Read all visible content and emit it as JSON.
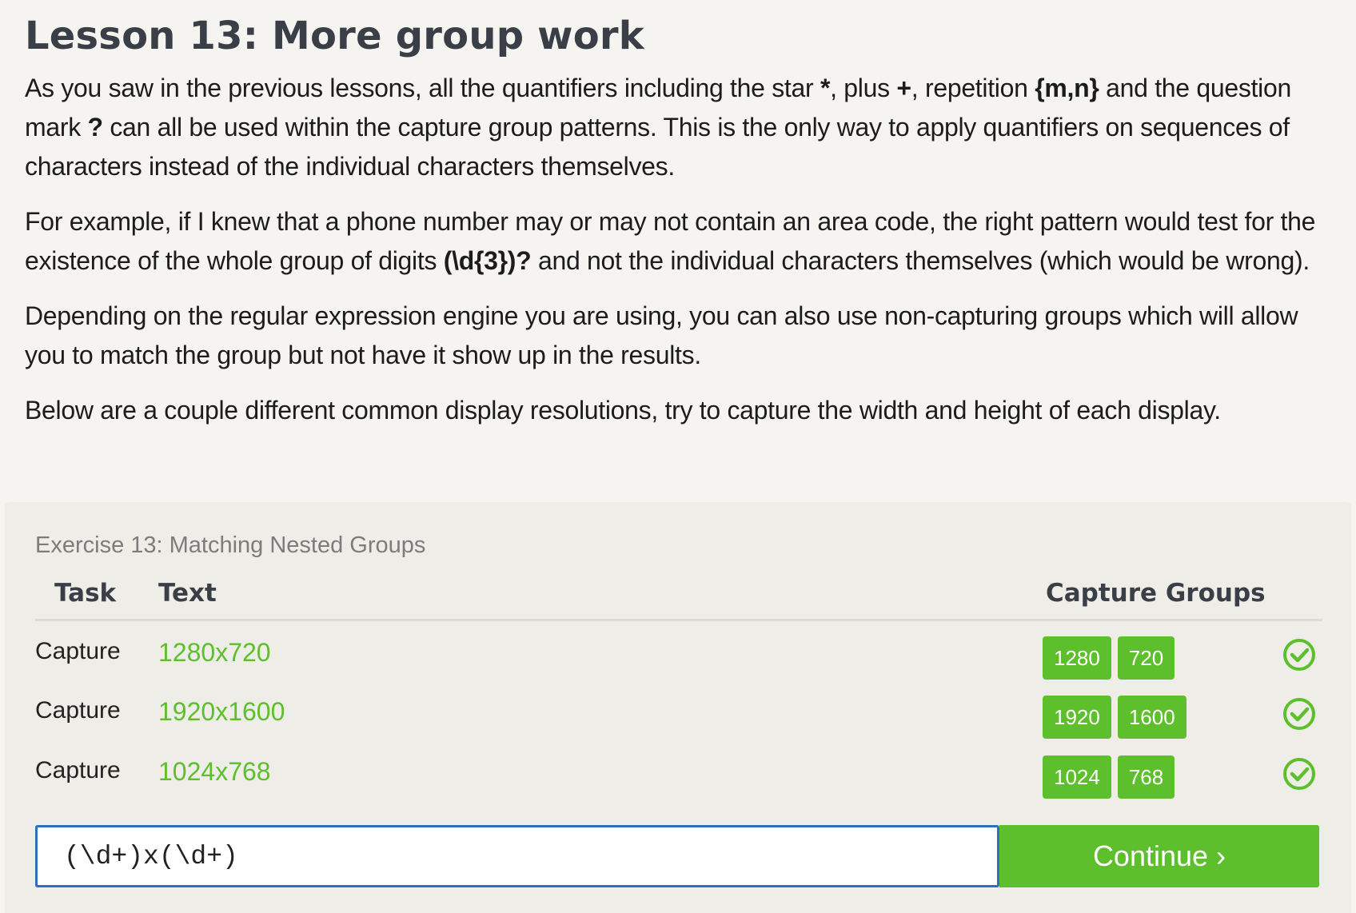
{
  "lesson": {
    "title": "Lesson 13: More group work",
    "paragraphs": [
      {
        "p1_a": "As you saw in the previous lessons, all the quantifiers including the star ",
        "p1_star": "*",
        "p1_b": ", plus ",
        "p1_plus": "+",
        "p1_c": ", repetition ",
        "p1_rep": "{m,n}",
        "p1_d": " and the question mark ",
        "p1_q": "?",
        "p1_e": " can all be used within the capture group patterns. This is the only way to apply quantifiers on sequences of characters instead of the individual characters themselves."
      },
      {
        "p2_a": "For example, if I knew that a phone number may or may not contain an area code, the right pattern would test for the existence of the whole group of digits ",
        "p2_code": "(\\d{3})?",
        "p2_b": " and not the individual characters themselves (which would be wrong)."
      },
      {
        "p3": "Depending on the regular expression engine you are using, you can also use non-capturing groups which will allow you to match the group but not have it show up in the results."
      },
      {
        "p4": "Below are a couple different common display resolutions, try to capture the width and height of each display."
      }
    ]
  },
  "exercise": {
    "title": "Exercise 13: Matching Nested Groups",
    "headers": {
      "task": "Task",
      "text": "Text",
      "capture_groups": "Capture Groups"
    },
    "rows": [
      {
        "task": "Capture",
        "text": "1280x720",
        "groups": [
          "1280",
          "720"
        ],
        "status": "check-icon"
      },
      {
        "task": "Capture",
        "text": "1920x1600",
        "groups": [
          "1920",
          "1600"
        ],
        "status": "check-icon"
      },
      {
        "task": "Capture",
        "text": "1024x768",
        "groups": [
          "1024",
          "768"
        ],
        "status": "check-icon"
      }
    ],
    "input_value": "(\\d+)x(\\d+)",
    "continue_label": "Continue ›"
  },
  "colors": {
    "accent_green": "#5dbf2b",
    "input_border": "#2f6fb5",
    "heading": "#3a3f47"
  }
}
